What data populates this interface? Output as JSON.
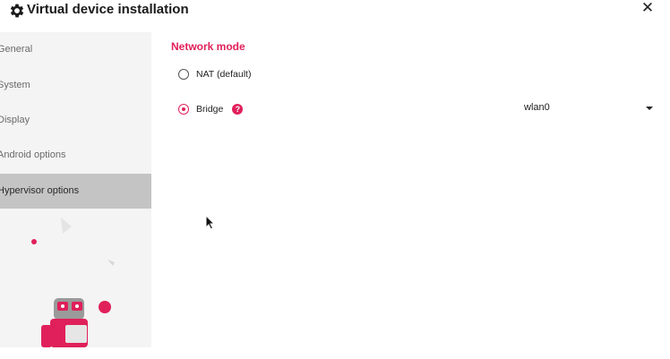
{
  "window": {
    "title": "Virtual device installation",
    "close_symbol": "✕",
    "title_icon": "gear-icon"
  },
  "sidebar": {
    "items": [
      {
        "label": "General",
        "active": false
      },
      {
        "label": "System",
        "active": false
      },
      {
        "label": "Display",
        "active": false
      },
      {
        "label": "Android options",
        "active": false
      },
      {
        "label": "Hypervisor options",
        "active": true
      }
    ]
  },
  "network": {
    "section_title": "Network mode",
    "options": [
      {
        "label": "NAT (default)",
        "selected": false
      },
      {
        "label": "Bridge",
        "selected": true
      }
    ],
    "help_symbol": "?",
    "interface_value": "wlan0"
  },
  "colors": {
    "accent": "#e0205a",
    "sidebar_bg": "#f4f4f4",
    "sidebar_active_bg": "#c4c4c4"
  }
}
